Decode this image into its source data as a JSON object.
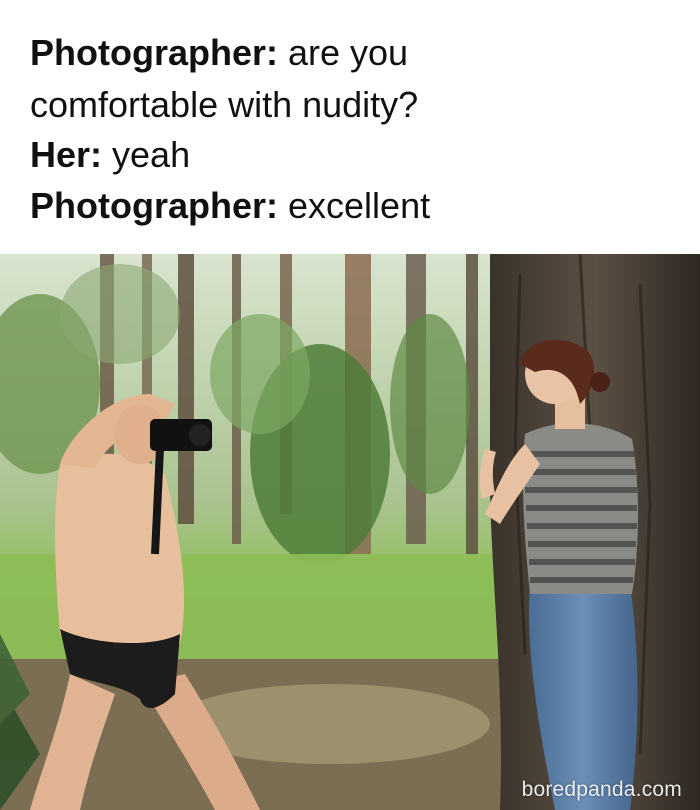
{
  "caption": {
    "line1": {
      "speaker": "Photographer:",
      "text": " are you"
    },
    "line2": {
      "text": "comfortable with nudity?"
    },
    "line3": {
      "speaker": "Her:",
      "text": " yeah"
    },
    "line4": {
      "speaker": "Photographer:",
      "text": " excellent"
    }
  },
  "photo": {
    "watermark": "boredpanda.com",
    "colors": {
      "sky": "#dfe9d6",
      "forest_far": "#7fa06a",
      "grass": "#8fbf5a",
      "ground": "#8c7d5e",
      "trunk": "#4a3f33",
      "skin": "#e8bf9c",
      "shirt_stripe_dark": "#4a4a4a",
      "shirt_stripe_light": "#b8b8b4",
      "jeans": "#5c7fa8",
      "hair": "#5a2a1c"
    }
  }
}
